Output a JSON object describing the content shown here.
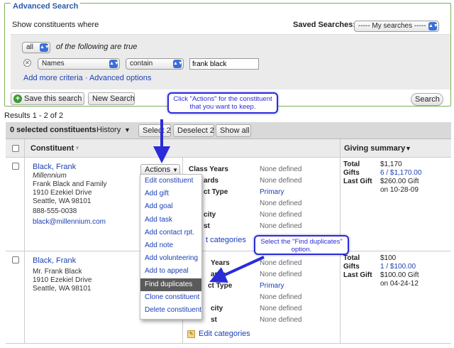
{
  "advanced_search": {
    "title": "Advanced Search",
    "show_where": "Show constituents where",
    "saved_label": "Saved Searches:",
    "saved_value": "----- My searches -----",
    "match_value": "all",
    "following_text": "of the following are true",
    "field_value": "Names",
    "operator_value": "contain",
    "criteria_value": "frank black",
    "more_criteria": "Add more criteria",
    "separator": "·",
    "advanced_options": "Advanced options",
    "save_search": "Save this search",
    "new_search": "New Search",
    "search": "Search"
  },
  "results": {
    "count": "Results 1 - 2 of 2",
    "selected": "0 selected constituents",
    "history": "History",
    "select": "Select 2",
    "deselect": "Deselect 2",
    "show_all": "Show all",
    "col_constituent": "Constituent",
    "col_giving": "Giving summary"
  },
  "rows": [
    {
      "name": "Black, Frank",
      "org": "Millennium",
      "lines": [
        "Frank Black and Family",
        "1910 Ezekiel Drive",
        "Seattle, WA 98101"
      ],
      "phone": "888-555-0038",
      "email": "black@millennium.com",
      "giving": {
        "total": "$1,170",
        "gifts": "6 / $1,170.00",
        "last_gift": "$260.00 Gift",
        "last_gift_date": "on 10-28-09"
      }
    },
    {
      "name": "Black, Frank",
      "lines": [
        "Mr. Frank Black",
        "1910 Ezekiel Drive",
        "Seattle, WA 98101"
      ],
      "giving": {
        "total": "$100",
        "gifts": "1 / $100.00",
        "last_gift": "$100.00 Gift",
        "last_gift_date": "on 04-24-12"
      }
    }
  ],
  "attributes": {
    "class_years": "Class Years",
    "awards_frag": "ards",
    "contact_type_frag": "ct Type",
    "ethnicity_frag": "city",
    "interest_frag": "st",
    "none": "None defined",
    "primary": "Primary",
    "edit_categories": "Edit categories",
    "edit_categories_frag": "t categories",
    "class_years_frag": "Years",
    "cs_frag": "st"
  },
  "giving_labels": {
    "total": "Total",
    "gifts": "Gifts",
    "last_gift": "Last Gift"
  },
  "actions": {
    "button": "Actions",
    "items": [
      "Edit constituent",
      "Add gift",
      "Add goal",
      "Add task",
      "Add contact rpt.",
      "Add note",
      "Add volunteering",
      "Add to appeal",
      "Find duplicates",
      "Clone constituent",
      "Delete constituent"
    ]
  },
  "callouts": {
    "first": "Click \"Actions\" for the constituent that you want to keep.",
    "second": "Select the \"Find duplicates\" option."
  },
  "colors": {
    "accent": "#2b2bd8",
    "link": "#1a3fb5",
    "panel_border": "#7fae5a",
    "highlight": "#5a5a5a"
  }
}
